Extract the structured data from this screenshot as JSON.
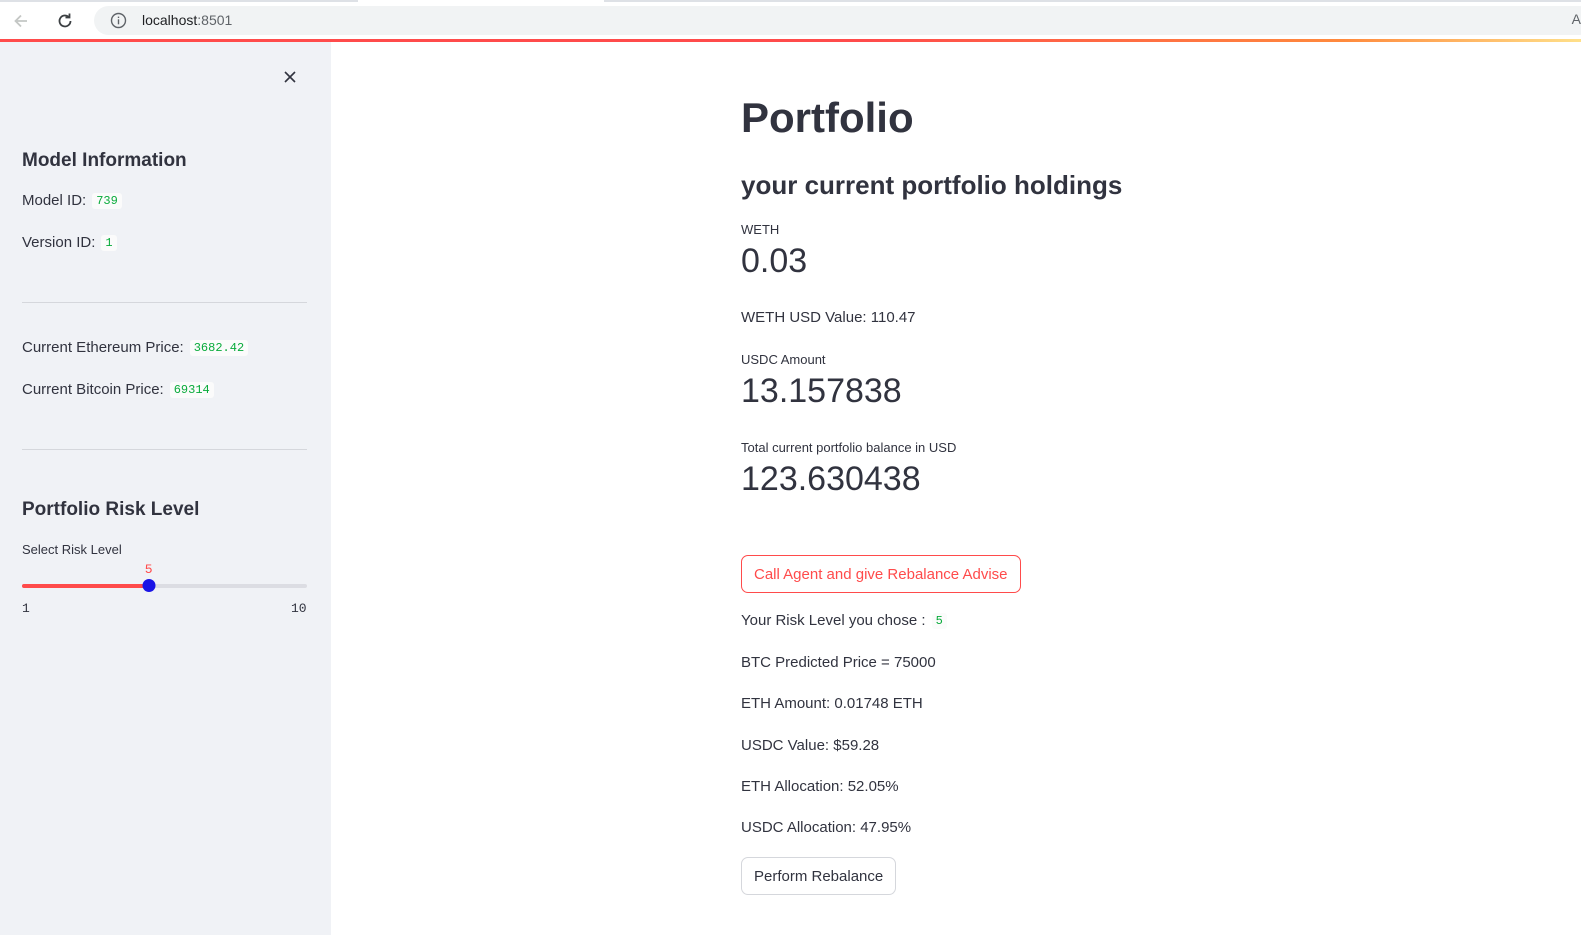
{
  "browser": {
    "url_host": "localhost",
    "url_port": ":8501",
    "edge_glyph": "A"
  },
  "sidebar": {
    "close_icon": "close-icon",
    "model_info": {
      "heading": "Model Information",
      "model_id_label": "Model ID:",
      "model_id_value": "739",
      "version_id_label": "Version ID:",
      "version_id_value": "1"
    },
    "prices": {
      "eth_label": "Current Ethereum Price:",
      "eth_value": "3682.42",
      "btc_label": "Current Bitcoin Price:",
      "btc_value": "69314"
    },
    "risk": {
      "heading": "Portfolio Risk Level",
      "slider_label": "Select Risk Level",
      "value": 5,
      "min": 1,
      "max": 10,
      "value_text": "5",
      "min_text": "1",
      "max_text": "10"
    }
  },
  "main": {
    "title": "Portfolio",
    "subtitle": "your current portfolio holdings",
    "weth": {
      "label": "WETH",
      "value": "0.03"
    },
    "weth_usd": "WETH USD Value: 110.47",
    "usdc": {
      "label": "USDC Amount",
      "value": "13.157838"
    },
    "total": {
      "label": "Total current portfolio balance in USD",
      "value": "123.630438"
    },
    "call_agent_button": "Call Agent and give Rebalance Advise",
    "risk_chose_label": "Your Risk Level you chose :",
    "risk_chose_value": "5",
    "btc_predicted": "BTC Predicted Price = 75000",
    "eth_amount": "ETH Amount: 0.01748 ETH",
    "usdc_value": "USDC Value: $59.28",
    "eth_allocation": "ETH Allocation: 52.05%",
    "usdc_allocation": "USDC Allocation: 47.95%",
    "perform_button": "Perform Rebalance"
  },
  "colors": {
    "accent": "#ff4b4b",
    "slider_thumb": "#1a14e6",
    "code_text": "#09ab3b",
    "sidebar_bg": "#f0f2f6"
  }
}
